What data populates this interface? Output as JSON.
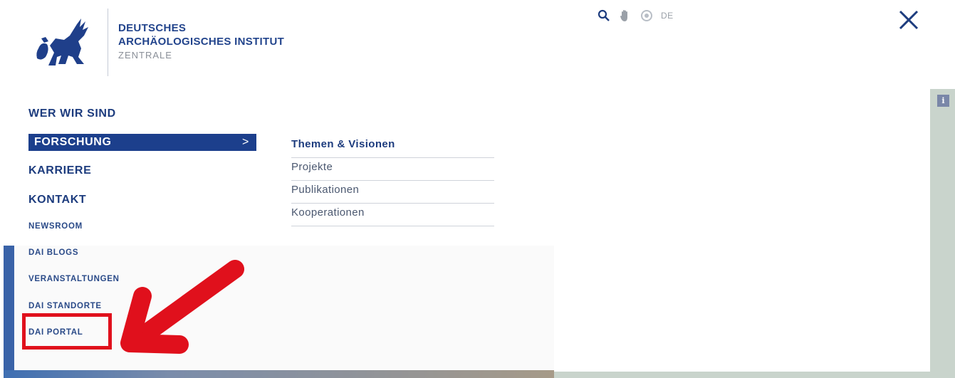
{
  "header": {
    "institute_line1": "DEUTSCHES",
    "institute_line2": "ARCHÄOLOGISCHES INSTITUT",
    "institute_line3": "ZENTRALE",
    "language": "DE",
    "icons": [
      "search-icon",
      "hand-icon",
      "accessibility-icon"
    ]
  },
  "nav": {
    "main": [
      "WER WIR SIND",
      "FORSCHUNG",
      "KARRIERE",
      "KONTAKT"
    ],
    "secondary": [
      "NEWSROOM",
      "DAI BLOGS",
      "VERANSTALTUNGEN",
      "DAI STANDORTE",
      "DAI PORTAL"
    ],
    "active_chevron": ">"
  },
  "submenu": {
    "items": [
      "Themen & Visionen",
      "Projekte",
      "Publikationen",
      "Kooperationen"
    ]
  },
  "info_label": "i",
  "colors": {
    "brand": "#1c3f8c",
    "highlight": "#e0101c"
  }
}
